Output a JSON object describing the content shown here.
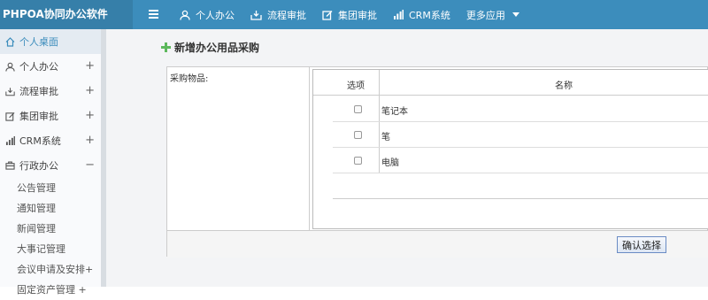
{
  "app": {
    "title": "PHPOA协同办公软件"
  },
  "topnav": {
    "items": [
      {
        "label": "个人办公",
        "icon": "user-icon"
      },
      {
        "label": "流程审批",
        "icon": "workflow-icon"
      },
      {
        "label": "集团审批",
        "icon": "edit-icon"
      },
      {
        "label": "CRM系统",
        "icon": "bar-chart-icon"
      }
    ],
    "more_label": "更多应用"
  },
  "sidebar": {
    "items": [
      {
        "label": "个人桌面",
        "icon": "home-icon",
        "active": true,
        "toggle": ""
      },
      {
        "label": "个人办公",
        "icon": "user-icon",
        "toggle": "+"
      },
      {
        "label": "流程审批",
        "icon": "workflow-icon",
        "toggle": "+"
      },
      {
        "label": "集团审批",
        "icon": "edit-icon",
        "toggle": "+"
      },
      {
        "label": "CRM系统",
        "icon": "bar-chart-icon",
        "toggle": "+"
      },
      {
        "label": "行政办公",
        "icon": "briefcase-icon",
        "toggle": "−"
      }
    ],
    "subitems": [
      "公告管理",
      "通知管理",
      "新闻管理",
      "大事记管理",
      "会议申请及安排+",
      "固定资产管理 +"
    ]
  },
  "page": {
    "title": "新增办公用品采购",
    "field_label": "采购物品:",
    "table": {
      "headers": {
        "select": "选项",
        "name": "名称"
      },
      "rows": [
        {
          "name": "笔记本"
        },
        {
          "name": "笔"
        },
        {
          "name": "电脑"
        }
      ]
    },
    "confirm_label": "确认选择"
  },
  "colors": {
    "topbar": "#3c8dbc",
    "brand": "#367fa9",
    "accent_green": "#5cb85c"
  }
}
